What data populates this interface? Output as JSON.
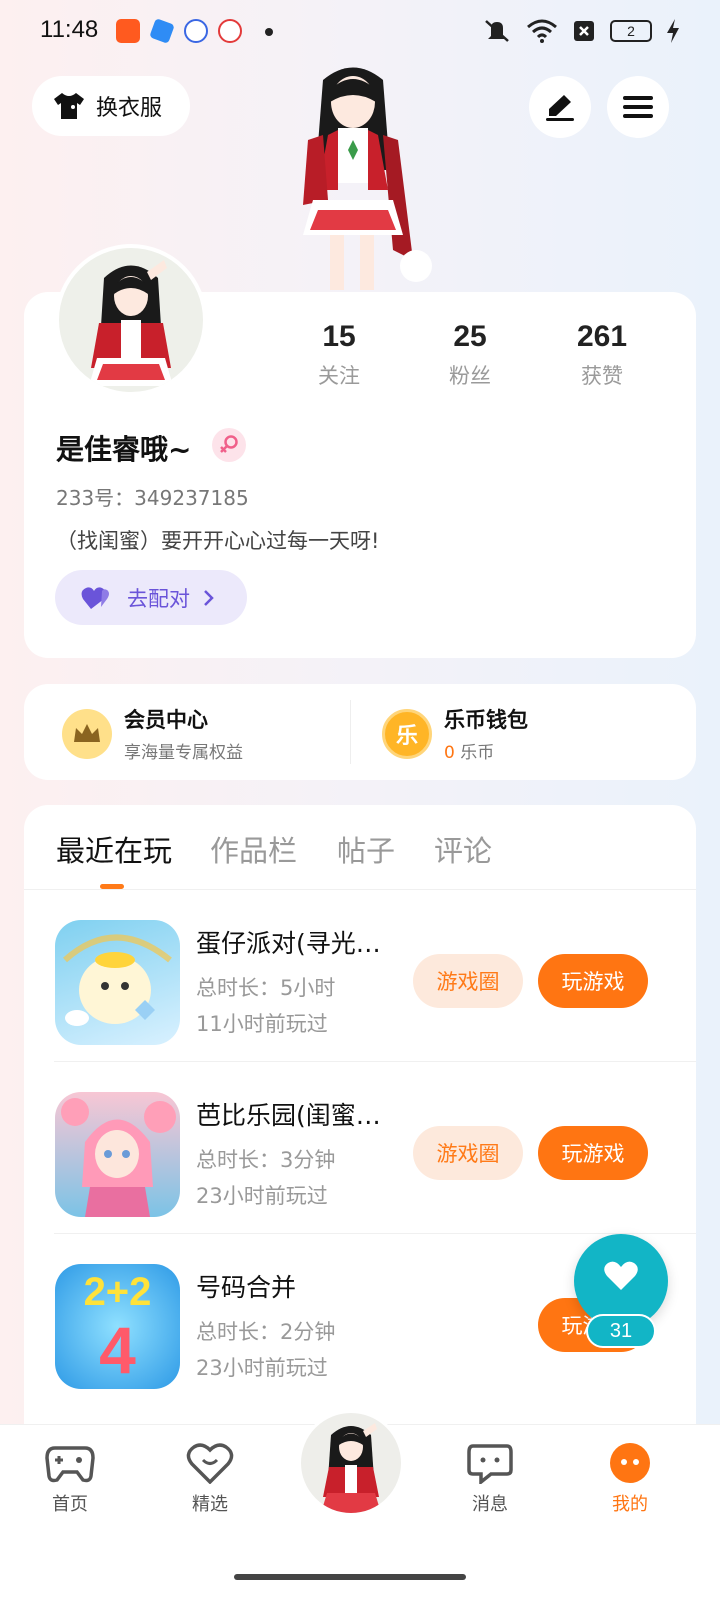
{
  "status_bar": {
    "time": "11:48",
    "battery": "2"
  },
  "header": {
    "outfit_label": "换衣服",
    "edit_icon": "pen-icon",
    "menu_icon": "hamburger-icon"
  },
  "profile": {
    "stats": [
      {
        "num": "15",
        "label": "关注"
      },
      {
        "num": "25",
        "label": "粉丝"
      },
      {
        "num": "261",
        "label": "获赞"
      }
    ],
    "nickname": "是佳睿哦~",
    "gender": "female",
    "uid": "233号：349237185",
    "bio": "（找闺蜜）要开开心心过每一天呀!",
    "match_label": "去配对"
  },
  "member": {
    "vip_title": "会员中心",
    "vip_sub": "享海量专属权益",
    "wallet_title": "乐币钱包",
    "wallet_amount": "0",
    "wallet_unit": " 乐币",
    "wallet_icon_char": "乐"
  },
  "tabs": [
    "最近在玩",
    "作品栏",
    "帖子",
    "评论"
  ],
  "games": [
    {
      "name": "蛋仔派对(寻光…",
      "duration": "总时长：5小时",
      "last": "11小时前玩过",
      "circle_label": "游戏圈",
      "play_label": "玩游戏"
    },
    {
      "name": "芭比乐园(闺蜜…",
      "duration": "总时长：3分钟",
      "last": "23小时前玩过",
      "circle_label": "游戏圈",
      "play_label": "玩游戏"
    },
    {
      "name": "号码合并",
      "duration": "总时长：2分钟",
      "last": "23小时前玩过",
      "circle_label": "",
      "play_label": "玩游戏"
    }
  ],
  "game3_icon_text": {
    "top": "2+2",
    "bottom": "4"
  },
  "float_like": {
    "count": "31"
  },
  "nav": [
    {
      "label": "首页",
      "icon": "gamepad-icon"
    },
    {
      "label": "精选",
      "icon": "heart-chat-icon"
    },
    {
      "label": "消息",
      "icon": "chat-icon"
    },
    {
      "label": "我的",
      "icon": "me-icon"
    }
  ],
  "colors": {
    "accent": "#ff7512",
    "match_purple": "#6a54d9",
    "like_teal": "#12b5c6"
  }
}
